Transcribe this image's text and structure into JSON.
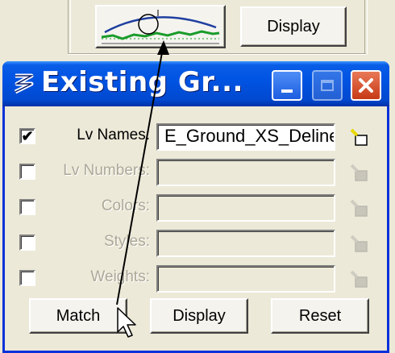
{
  "toolbar": {
    "display_label": "Display"
  },
  "dialog": {
    "title": "Existing Gr...",
    "rows": [
      {
        "label": "Lv Names:",
        "checked": true,
        "enabled": true,
        "value": "E_Ground_XS_Deline"
      },
      {
        "label": "Lv Numbers:",
        "checked": false,
        "enabled": false,
        "value": ""
      },
      {
        "label": "Colors:",
        "checked": false,
        "enabled": false,
        "value": ""
      },
      {
        "label": "Styles:",
        "checked": false,
        "enabled": false,
        "value": ""
      },
      {
        "label": "Weights:",
        "checked": false,
        "enabled": false,
        "value": ""
      }
    ],
    "buttons": {
      "match": "Match",
      "display": "Display",
      "reset": "Reset"
    },
    "check_glyph": "✔"
  },
  "colors": {
    "title_bar": "#0054e3",
    "close_button": "#c73a16",
    "profile_line": "#1a9c2a",
    "profile_curve": "#1f3fa0"
  },
  "icons": [
    "app-icon",
    "minimize-icon",
    "maximize-icon",
    "close-icon",
    "pick-element-icon",
    "profile-graphic-icon",
    "mouse-cursor-icon"
  ]
}
